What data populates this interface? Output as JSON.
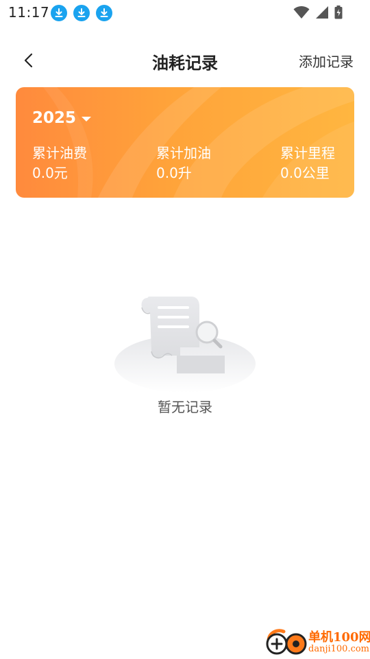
{
  "status_bar": {
    "time": "11:17",
    "notification_icons": [
      "download-icon",
      "download-icon",
      "download-icon"
    ],
    "system_icons": [
      "wifi-icon",
      "signal-icon",
      "battery-charging-icon"
    ]
  },
  "header": {
    "title": "油耗记录",
    "add_label": "添加记录",
    "back_icon": "back-arrow-icon"
  },
  "summary": {
    "year": "2025",
    "stats": [
      {
        "label": "累计油费",
        "value": "0.0元"
      },
      {
        "label": "累计加油",
        "value": "0.0升"
      },
      {
        "label": "累计里程",
        "value": "0.0公里"
      }
    ],
    "gradient_colors": [
      "#ff8a3d",
      "#ffb640"
    ]
  },
  "empty_state": {
    "text": "暂无记录",
    "icon": "empty-document-search-icon"
  },
  "watermark": {
    "title": "单机100网",
    "url": "danji100.com"
  }
}
